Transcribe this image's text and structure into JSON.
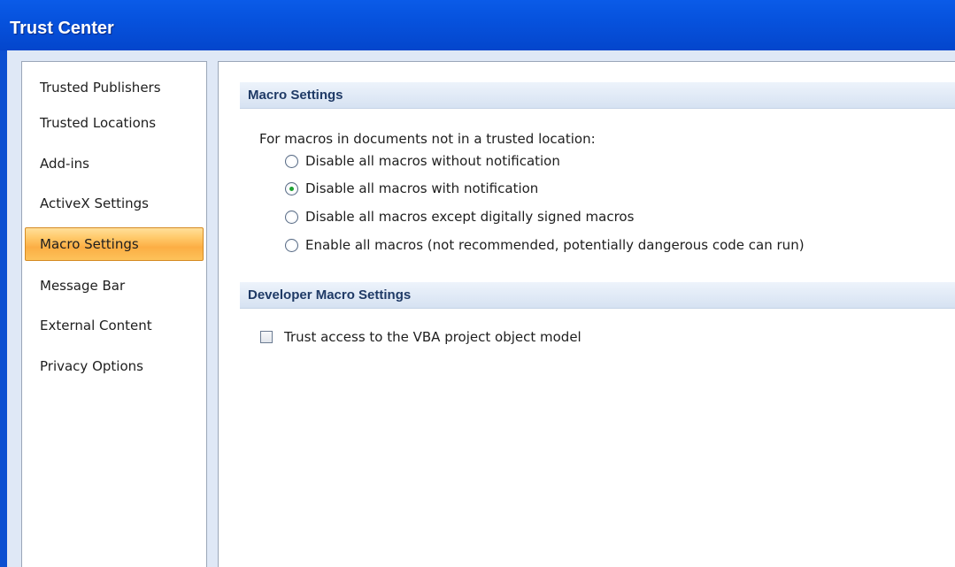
{
  "window": {
    "title": "Trust Center"
  },
  "nav": {
    "items": [
      {
        "label": "Trusted Publishers"
      },
      {
        "label": "Trusted Locations"
      },
      {
        "label": "Add-ins"
      },
      {
        "label": "ActiveX Settings"
      },
      {
        "label": "Macro Settings",
        "selected": true
      },
      {
        "label": "Message Bar"
      },
      {
        "label": "External Content"
      },
      {
        "label": "Privacy Options"
      }
    ]
  },
  "macro_settings": {
    "header": "Macro Settings",
    "description": "For macros in documents not in a trusted location:",
    "options": [
      {
        "label": "Disable all macros without notification",
        "checked": false
      },
      {
        "label": "Disable all macros with notification",
        "checked": true
      },
      {
        "label": "Disable all macros except digitally signed macros",
        "checked": false
      },
      {
        "label": "Enable all macros (not recommended, potentially dangerous code can run)",
        "checked": false
      }
    ]
  },
  "developer_settings": {
    "header": "Developer Macro Settings",
    "vba_access_label": "Trust access to the VBA project object model",
    "vba_access_checked": false
  },
  "colors": {
    "title_bar": "#0651dc",
    "selected_item": "#fcae44",
    "radio_dot": "#1ea233"
  }
}
